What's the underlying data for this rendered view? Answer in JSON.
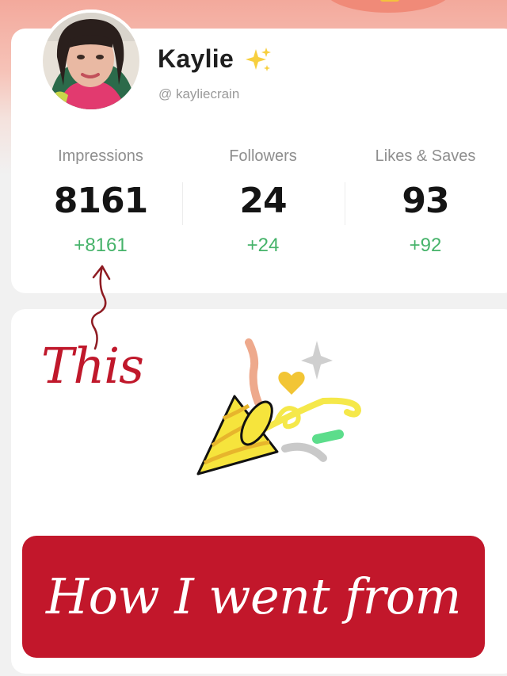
{
  "profile": {
    "name": "Kaylie",
    "name_emoji": "sparkles-icon",
    "handle": "@ kayliecrain"
  },
  "stats": [
    {
      "label": "Impressions",
      "value": "8161",
      "delta": "+8161"
    },
    {
      "label": "Followers",
      "value": "24",
      "delta": "+24"
    },
    {
      "label": "Likes & Saves",
      "value": "93",
      "delta": "+92"
    }
  ],
  "annotation": {
    "text": "This",
    "icon": "curly-arrow-icon"
  },
  "celebration": {
    "icon": "party-popper-icon"
  },
  "banner": {
    "text": "How I went from"
  },
  "colors": {
    "accent_red": "#c2172b",
    "delta_green": "#46b36a",
    "top_gradient": "#f3a99c"
  }
}
